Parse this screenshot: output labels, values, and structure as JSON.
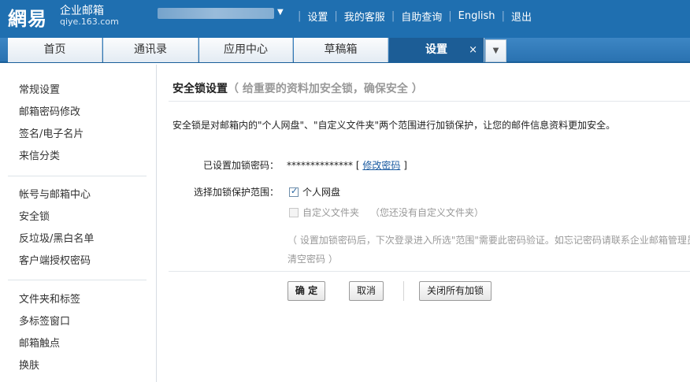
{
  "header": {
    "logo_main": "網易",
    "logo_sub": "企业邮箱",
    "logo_domain": "qiye.163.com",
    "nav": [
      {
        "label": "设置"
      },
      {
        "label": "我的客服"
      },
      {
        "label": "自助查询"
      },
      {
        "label": "English"
      },
      {
        "label": "退出"
      }
    ]
  },
  "tabs": [
    {
      "label": "首页"
    },
    {
      "label": "通讯录"
    },
    {
      "label": "应用中心"
    },
    {
      "label": "草稿箱"
    },
    {
      "label": "设置",
      "close": "×"
    }
  ],
  "sidebar": {
    "group1": [
      {
        "label": "常规设置"
      },
      {
        "label": "邮箱密码修改"
      },
      {
        "label": "签名/电子名片"
      },
      {
        "label": "来信分类"
      }
    ],
    "group2": [
      {
        "label": "帐号与邮箱中心"
      },
      {
        "label": "安全锁"
      },
      {
        "label": "反垃圾/黑白名单"
      },
      {
        "label": "客户端授权密码"
      }
    ],
    "group3": [
      {
        "label": "文件夹和标签"
      },
      {
        "label": "多标签窗口"
      },
      {
        "label": "邮箱触点"
      },
      {
        "label": "换肤"
      }
    ]
  },
  "main": {
    "title": "安全锁设置",
    "title_note": "（ 给重要的资料加安全锁，确保安全 ）",
    "description": "安全锁是对邮箱内的\"个人网盘\"、\"自定义文件夹\"两个范围进行加锁保护，让您的邮件信息资料更加安全。",
    "pwd_label": "已设置加锁密码：",
    "pwd_mask": "**************",
    "pwd_bracket_open": "[",
    "pwd_link": "修改密码",
    "pwd_bracket_close": "]",
    "scope_label": "选择加锁保护范围：",
    "option1": {
      "label": "个人网盘",
      "checked": true
    },
    "option2": {
      "label": "自定义文件夹",
      "hint": "（您还没有自定义文件夹）",
      "checked": false,
      "disabled": true
    },
    "note_line1": "（ 设置加锁密码后，下次登录进入所选\"范围\"需要此密码验证。如忘记密码请联系企业邮箱管理员",
    "note_line2": "清空密码 ）",
    "buttons": {
      "confirm": "确 定",
      "cancel": "取消",
      "close_all": "关闭所有加锁"
    }
  },
  "colors": {
    "header_bg": "#1f6fb0",
    "active_tab": "#1c5d96",
    "link": "#1a5aa0"
  }
}
